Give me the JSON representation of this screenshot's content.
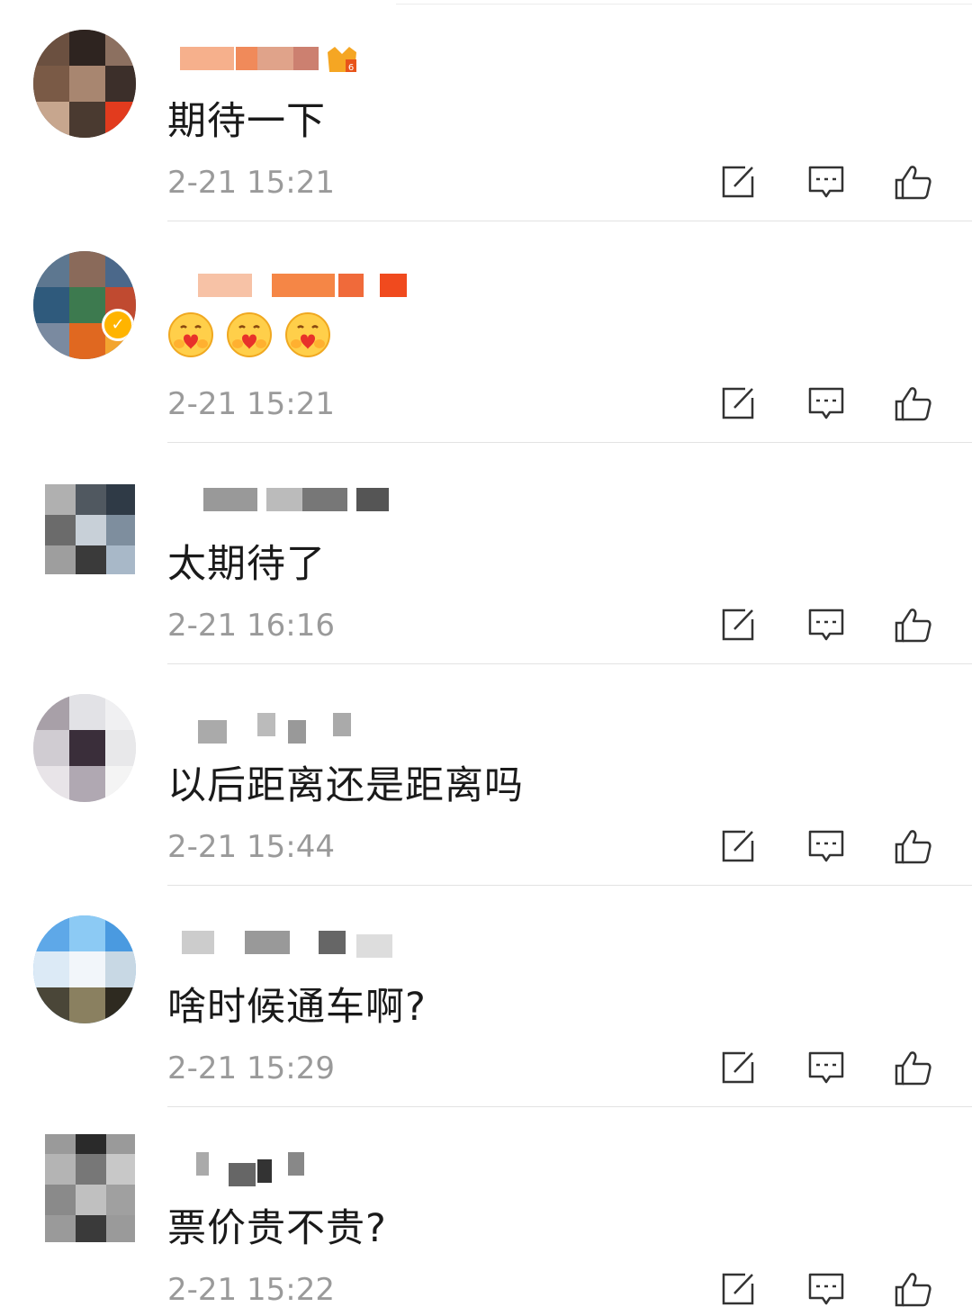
{
  "comments": [
    {
      "text": "期待一下",
      "time": "2-21 15:21"
    },
    {
      "text": "",
      "emojis": [
        "hug-emoji",
        "hug-emoji",
        "hug-emoji"
      ],
      "time": "2-21 15:21"
    },
    {
      "text": "太期待了",
      "time": "2-21 16:16"
    },
    {
      "text": "以后距离还是距离吗",
      "time": "2-21 15:44"
    },
    {
      "text": "啥时候通车啊?",
      "time": "2-21 15:29"
    },
    {
      "text": "票价贵不贵?",
      "time": "2-21 15:22"
    }
  ],
  "icons": {
    "repost": "repost-icon",
    "reply": "comment-icon",
    "like": "thumbs-up-icon"
  },
  "colors": {
    "text": "#1a1a1a",
    "time": "#9a9a9a",
    "icon": "#333333",
    "divider": "#e3e3e3"
  }
}
